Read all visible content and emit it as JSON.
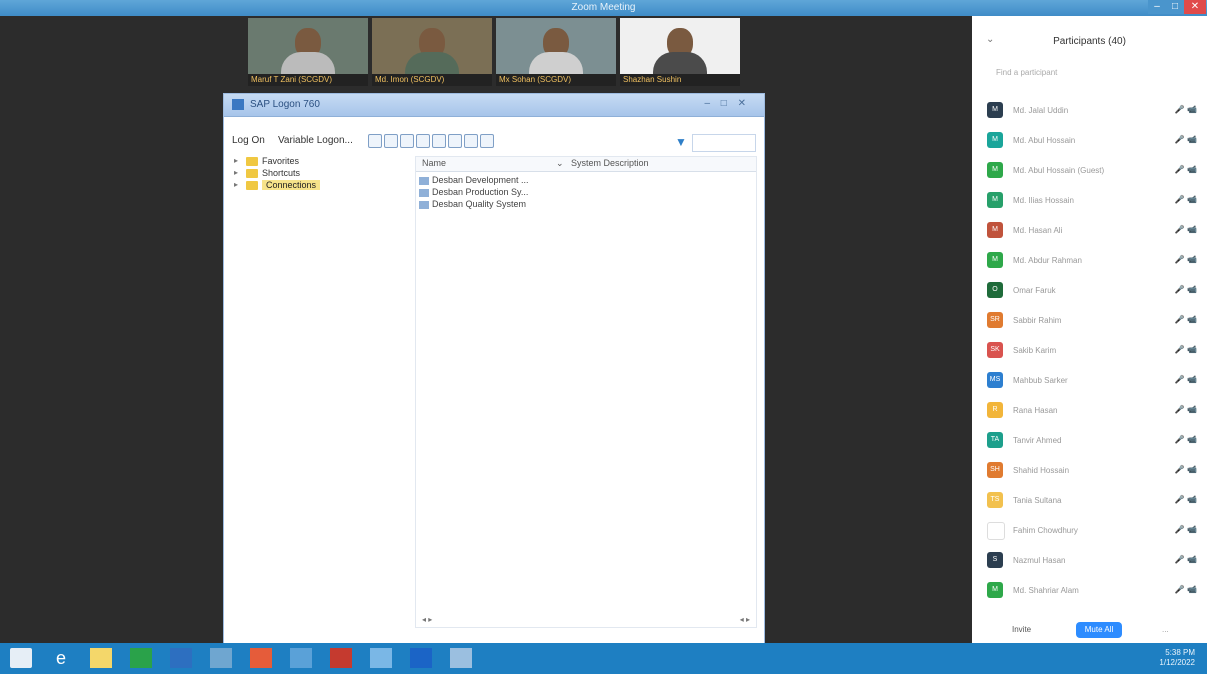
{
  "window": {
    "title": "Zoom Meeting",
    "min_label": "–",
    "max_label": "□",
    "close_label": "✕"
  },
  "videos": [
    {
      "name": "Maruf T Zani (SCGDV)",
      "bg": "#6a7a6f",
      "shirt": "#bbbbbb"
    },
    {
      "name": "Md. Imon (SCGDV)",
      "bg": "#7b6f55",
      "shirt": "#556b5a"
    },
    {
      "name": "Mx Sohan (SCGDV)",
      "bg": "#7c8f92",
      "shirt": "#cfcfcf"
    },
    {
      "name": "Shazhan Sushin",
      "bg": "#f0f0f0",
      "shirt": "#4b4b4b"
    }
  ],
  "sap": {
    "title": "SAP Logon 760",
    "toolbar": {
      "logon": "Log On",
      "variable_logon": "Variable Logon..."
    },
    "tree": [
      {
        "label": "Favorites",
        "selected": false
      },
      {
        "label": "Shortcuts",
        "selected": false
      },
      {
        "label": "Connections",
        "selected": true
      }
    ],
    "columns": {
      "name": "Name",
      "desc": "System Description"
    },
    "systems": [
      "Desban Development ...",
      "Desban Production Sy...",
      "Desban Quality System"
    ]
  },
  "participants": {
    "title": "Participants (40)",
    "search_placeholder": "Find a participant",
    "list": [
      {
        "initials": "M",
        "name": "Md. Jalal Uddin",
        "color": "#2c3e50"
      },
      {
        "initials": "M",
        "name": "Md. Abul Hossain",
        "color": "#1aa59a"
      },
      {
        "initials": "M",
        "name": "Md. Abul Hossain (Guest)",
        "color": "#2ea84a"
      },
      {
        "initials": "M",
        "name": "Md. Ilias Hossain",
        "color": "#27a06a"
      },
      {
        "initials": "M",
        "name": "Md. Hasan Ali",
        "color": "#c0533c"
      },
      {
        "initials": "M",
        "name": "Md. Abdur Rahman",
        "color": "#2ea84a"
      },
      {
        "initials": "O",
        "name": "Omar Faruk",
        "color": "#1f6b3a"
      },
      {
        "initials": "SR",
        "name": "Sabbir Rahim",
        "color": "#e07b30"
      },
      {
        "initials": "SK",
        "name": "Sakib Karim",
        "color": "#d9534f"
      },
      {
        "initials": "MS",
        "name": "Mahbub Sarker",
        "color": "#2d7fd0"
      },
      {
        "initials": "R",
        "name": "Rana Hasan",
        "color": "#f2b53a"
      },
      {
        "initials": "TA",
        "name": "Tanvir Ahmed",
        "color": "#1d9f8c"
      },
      {
        "initials": "SH",
        "name": "Shahid Hossain",
        "color": "#e07b30"
      },
      {
        "initials": "TS",
        "name": "Tania Sultana",
        "color": "#f2c14e"
      },
      {
        "initials": "",
        "name": "Fahim Chowdhury",
        "color": "#ffffff"
      },
      {
        "initials": "S",
        "name": "Nazmul Hasan",
        "color": "#2c3e50"
      },
      {
        "initials": "M",
        "name": "Md. Shahriar Alam",
        "color": "#2ea84a"
      }
    ],
    "status_icons": "🎤 📹",
    "invite": "Invite",
    "mute_all": "Mute All",
    "more": "..."
  },
  "taskbar": {
    "time": "5:38 PM",
    "date": "1/12/2022"
  }
}
